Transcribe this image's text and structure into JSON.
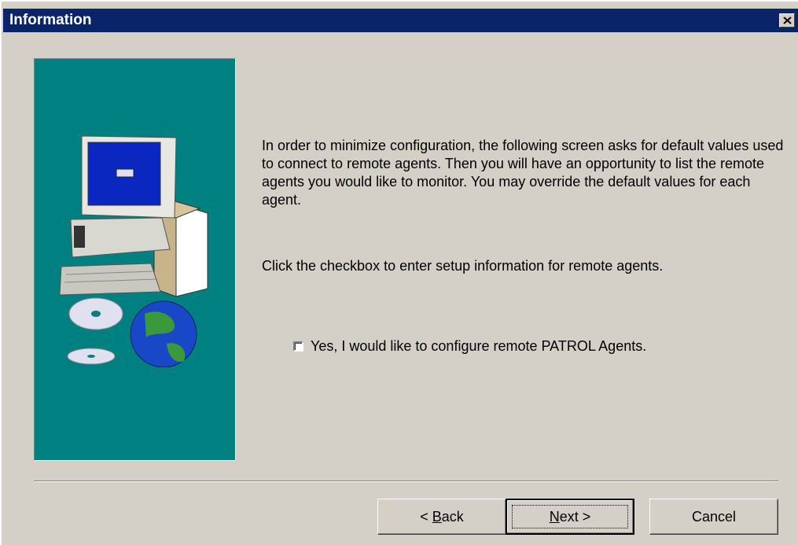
{
  "window": {
    "title": "Information",
    "close_icon": "close-icon"
  },
  "content": {
    "paragraph1": "In order to minimize configuration, the following screen asks for default values used to connect to remote agents.  Then you will have an opportunity to list the remote agents you would like to monitor.  You may override the default values for each agent.",
    "paragraph2": "Click the checkbox to enter setup information for remote agents.",
    "checkbox_label": "Yes, I would like to configure remote PATROL Agents.",
    "checkbox_checked": false
  },
  "buttons": {
    "back_arrow": "<",
    "back_mnemonic": "B",
    "back_rest": "ack",
    "next_mnemonic": "N",
    "next_rest": "ext",
    "next_arrow": ">",
    "cancel": "Cancel"
  },
  "colors": {
    "titlebar": "#0a246a",
    "panel": "#008080",
    "face": "#d4d0c8"
  },
  "illustration": {
    "icon": "computer-globe-cd-illustration"
  }
}
